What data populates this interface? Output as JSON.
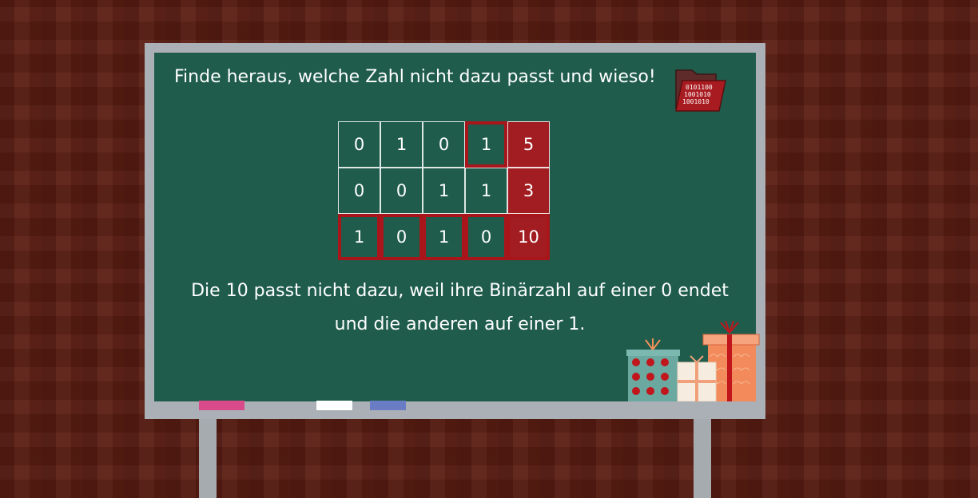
{
  "board": {
    "question": "Finde heraus, welche Zahl nicht dazu passt und wieso!",
    "folder_icon_text": [
      "0101100",
      "1001010",
      "1001010"
    ],
    "table": {
      "rows": [
        {
          "bits": [
            "0",
            "1",
            "0",
            "1"
          ],
          "number": "5"
        },
        {
          "bits": [
            "0",
            "0",
            "1",
            "1"
          ],
          "number": "3"
        },
        {
          "bits": [
            "1",
            "0",
            "1",
            "0"
          ],
          "number": "10"
        }
      ]
    },
    "answer_line1": "Die 10 passt nicht dazu, weil ihre Binärzahl auf einer 0 endet",
    "answer_line2": "und die anderen auf einer 1."
  },
  "colors": {
    "wood": "#5a1d12",
    "chalkboard": "#1f5c4b",
    "frame": "#aab0b5",
    "number_cell": "#a21d22",
    "highlight": "#a8161b",
    "chalk_pink": "#d94a8a",
    "chalk_white": "#ffffff",
    "chalk_blue": "#6a7cc4"
  },
  "decorations": [
    "binary-folder-icon",
    "gift-boxes-icon"
  ]
}
